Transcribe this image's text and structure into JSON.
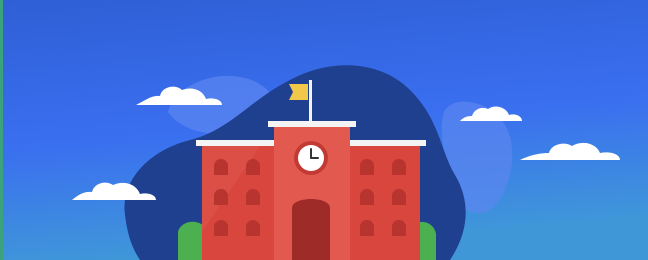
{
  "colors": {
    "sky_top": "#2f5fd6",
    "sky_mid": "#3a6ff0",
    "sky_bottom": "#3f97d8",
    "left_edge": "#3aa37e",
    "blob_dark": "#1f3f8f",
    "blob_light": "#5b86f0",
    "cloud": "#ffffff",
    "building_main": "#d8463e",
    "building_light": "#e25a4f",
    "building_shadow": "#b63a34",
    "window": "#b8342f",
    "door": "#9e2b27",
    "roof_trim": "#f4f4f4",
    "clock_face": "#ffffff",
    "clock_rim": "#c23a34",
    "flag": "#f2c84b",
    "flagpole": "#f4f4f4",
    "bush": "#4caf50"
  },
  "illustration": {
    "subject": "school-building",
    "icons": [
      "school-building-icon",
      "clock-icon",
      "flag-icon",
      "cloud-icon",
      "bush-icon"
    ]
  }
}
